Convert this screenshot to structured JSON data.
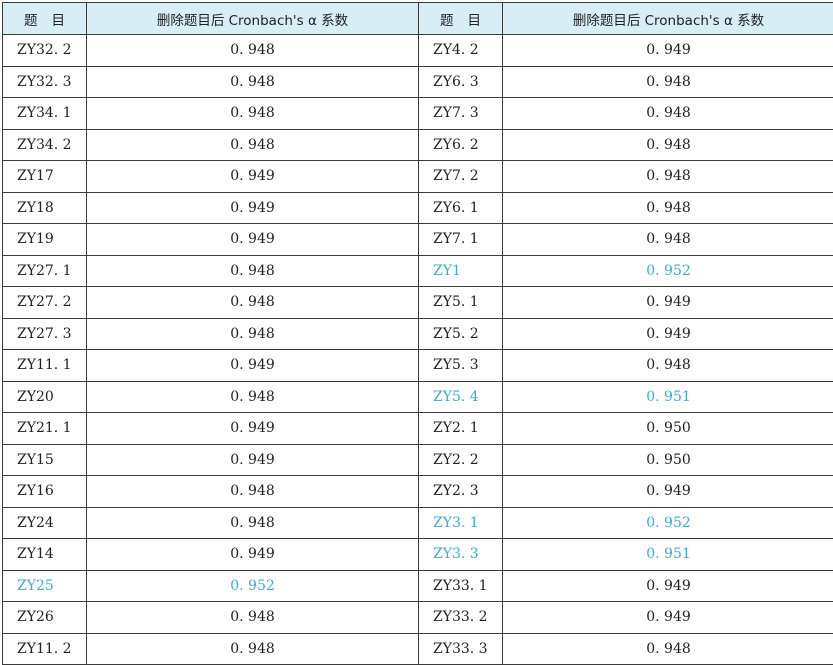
{
  "table": {
    "headers": {
      "item_left": [
        "题",
        "目"
      ],
      "value_left": "删除题目后 Cronbach's α 系数",
      "item_right": [
        "题",
        "目"
      ],
      "value_right": "删除题目后 Cronbach's α 系数"
    },
    "highlight_color": "#3aaed0",
    "header_bg": "#d7eef7",
    "rows": [
      {
        "l_item": "ZY32. 2",
        "l_val": "0. 948",
        "r_item": "ZY4. 2",
        "r_val": "0. 949",
        "l_hl": false,
        "r_hl": false
      },
      {
        "l_item": "ZY32. 3",
        "l_val": "0. 948",
        "r_item": "ZY6. 3",
        "r_val": "0. 948",
        "l_hl": false,
        "r_hl": false
      },
      {
        "l_item": "ZY34. 1",
        "l_val": "0. 948",
        "r_item": "ZY7. 3",
        "r_val": "0. 948",
        "l_hl": false,
        "r_hl": false
      },
      {
        "l_item": "ZY34. 2",
        "l_val": "0. 948",
        "r_item": "ZY6. 2",
        "r_val": "0. 948",
        "l_hl": false,
        "r_hl": false
      },
      {
        "l_item": "ZY17",
        "l_val": "0. 949",
        "r_item": "ZY7. 2",
        "r_val": "0. 948",
        "l_hl": false,
        "r_hl": false
      },
      {
        "l_item": "ZY18",
        "l_val": "0. 949",
        "r_item": "ZY6. 1",
        "r_val": "0. 948",
        "l_hl": false,
        "r_hl": false
      },
      {
        "l_item": "ZY19",
        "l_val": "0. 949",
        "r_item": "ZY7. 1",
        "r_val": "0. 948",
        "l_hl": false,
        "r_hl": false
      },
      {
        "l_item": "ZY27. 1",
        "l_val": "0. 948",
        "r_item": "ZY1",
        "r_val": "0. 952",
        "l_hl": false,
        "r_hl": true
      },
      {
        "l_item": "ZY27. 2",
        "l_val": "0. 948",
        "r_item": "ZY5. 1",
        "r_val": "0. 949",
        "l_hl": false,
        "r_hl": false
      },
      {
        "l_item": "ZY27. 3",
        "l_val": "0. 948",
        "r_item": "ZY5. 2",
        "r_val": "0. 949",
        "l_hl": false,
        "r_hl": false
      },
      {
        "l_item": "ZY11. 1",
        "l_val": "0. 949",
        "r_item": "ZY5. 3",
        "r_val": "0. 948",
        "l_hl": false,
        "r_hl": false
      },
      {
        "l_item": "ZY20",
        "l_val": "0. 948",
        "r_item": "ZY5. 4",
        "r_val": "0. 951",
        "l_hl": false,
        "r_hl": true
      },
      {
        "l_item": "ZY21. 1",
        "l_val": "0. 949",
        "r_item": "ZY2. 1",
        "r_val": "0. 950",
        "l_hl": false,
        "r_hl": false
      },
      {
        "l_item": "ZY15",
        "l_val": "0. 949",
        "r_item": "ZY2. 2",
        "r_val": "0. 950",
        "l_hl": false,
        "r_hl": false
      },
      {
        "l_item": "ZY16",
        "l_val": "0. 948",
        "r_item": "ZY2. 3",
        "r_val": "0. 949",
        "l_hl": false,
        "r_hl": false
      },
      {
        "l_item": "ZY24",
        "l_val": "0. 948",
        "r_item": "ZY3. 1",
        "r_val": "0. 952",
        "l_hl": false,
        "r_hl": true
      },
      {
        "l_item": "ZY14",
        "l_val": "0. 949",
        "r_item": "ZY3. 3",
        "r_val": "0. 951",
        "l_hl": false,
        "r_hl": true
      },
      {
        "l_item": "ZY25",
        "l_val": "0. 952",
        "r_item": "ZY33. 1",
        "r_val": "0. 949",
        "l_hl": true,
        "r_hl": false
      },
      {
        "l_item": "ZY26",
        "l_val": "0. 948",
        "r_item": "ZY33. 2",
        "r_val": "0. 949",
        "l_hl": false,
        "r_hl": false
      },
      {
        "l_item": "ZY11. 2",
        "l_val": "0. 948",
        "r_item": "ZY33. 3",
        "r_val": "0. 948",
        "l_hl": false,
        "r_hl": false
      }
    ]
  }
}
